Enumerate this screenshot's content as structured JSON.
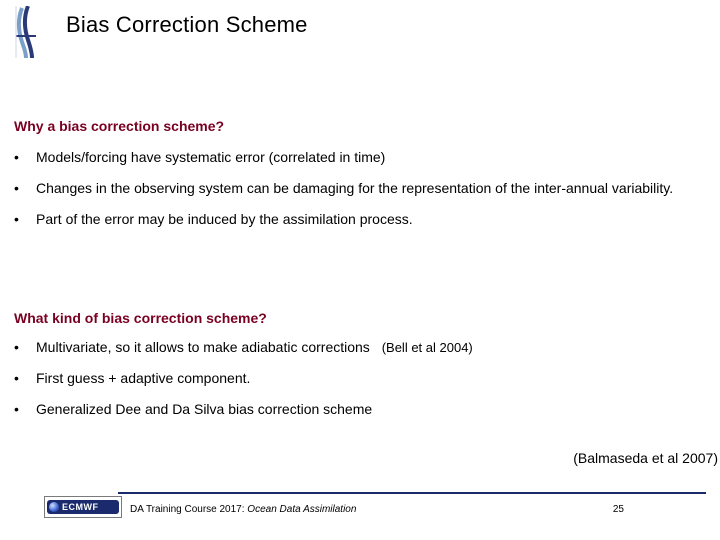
{
  "title": "Bias Correction Scheme",
  "section1": {
    "heading": "Why a bias correction scheme?",
    "bullets": [
      "Models/forcing have systematic error (correlated in time)",
      "Changes in the observing system can be damaging for the representation of the inter-annual variability.",
      "Part of the error may be induced by the assimilation process."
    ]
  },
  "section2": {
    "heading": "What kind of bias correction scheme?",
    "bullets": [
      "Multivariate, so it  allows to make adiabatic corrections",
      "First guess + adaptive component.",
      "Generalized Dee and Da Silva bias correction scheme"
    ],
    "inline_ref": "(Bell et al 2004)"
  },
  "ref_bottom": "(Balmaseda et al 2007)",
  "footer": {
    "logo_text": "ECMWF",
    "course": "DA Training Course 2017: ",
    "topic": "Ocean Data Assimilation",
    "slide_number": "25"
  },
  "bullet_glyph": "•"
}
